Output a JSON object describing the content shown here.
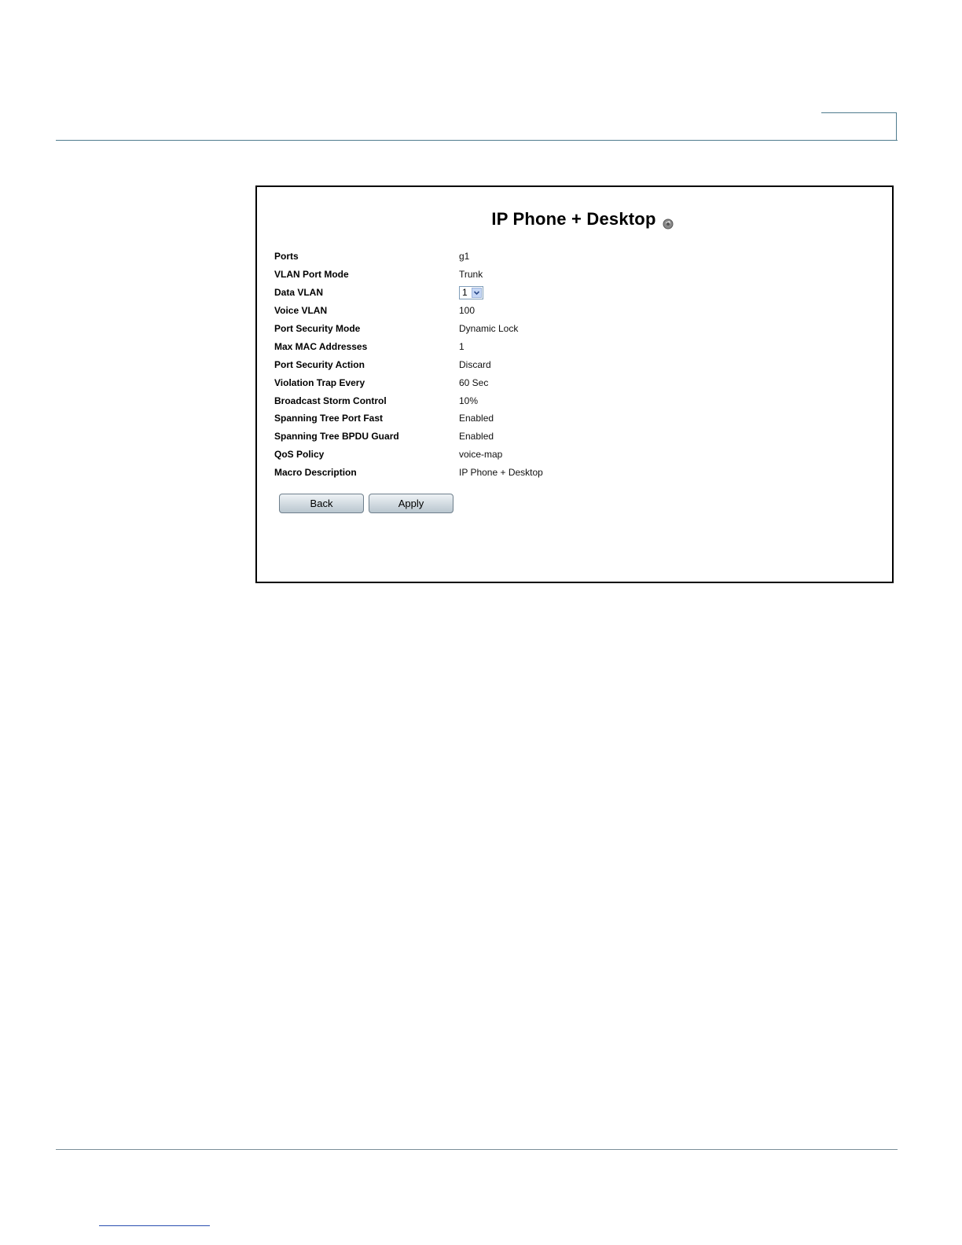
{
  "page": {
    "title": "IP Phone + Desktop",
    "help_icon": "help-icon"
  },
  "fields": [
    {
      "label": "Ports",
      "value": "g1"
    },
    {
      "label": "VLAN Port Mode",
      "value": "Trunk"
    },
    {
      "label": "Data VLAN",
      "value": "1",
      "type": "select"
    },
    {
      "label": "Voice VLAN",
      "value": "100"
    },
    {
      "label": "Port Security Mode",
      "value": "Dynamic Lock"
    },
    {
      "label": "Max MAC Addresses",
      "value": "1"
    },
    {
      "label": "Port Security Action",
      "value": "Discard"
    },
    {
      "label": "Violation Trap Every",
      "value": "60 Sec"
    },
    {
      "label": "Broadcast Storm Control",
      "value": "10%"
    },
    {
      "label": "Spanning Tree Port Fast",
      "value": "Enabled"
    },
    {
      "label": "Spanning Tree BPDU Guard",
      "value": "Enabled"
    },
    {
      "label": "QoS Policy",
      "value": "voice-map"
    },
    {
      "label": "Macro Description",
      "value": "IP Phone + Desktop"
    }
  ],
  "buttons": {
    "back": "Back",
    "apply": "Apply"
  }
}
